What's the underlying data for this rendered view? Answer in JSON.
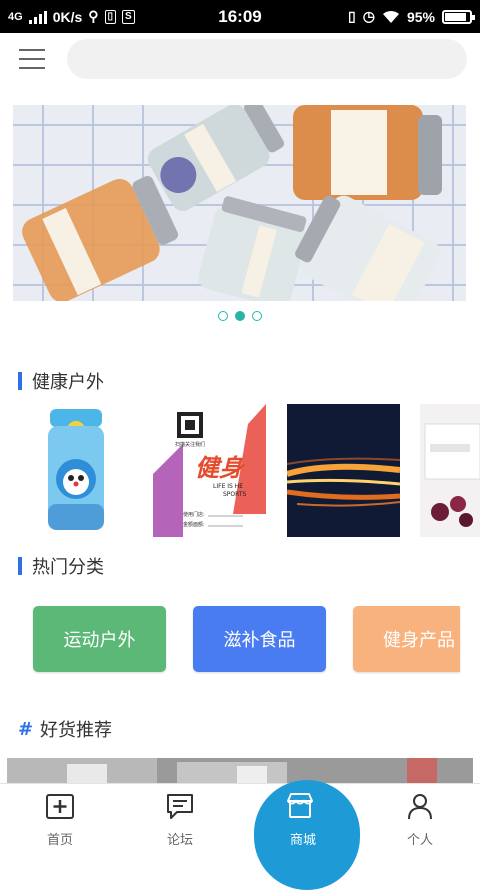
{
  "status_bar": {
    "network": "4G",
    "speed": "0K/s",
    "time": "16:09",
    "battery": "95%"
  },
  "header": {
    "search_placeholder": ""
  },
  "banner": {
    "dot_count": 3,
    "active_dot": 2
  },
  "sections": {
    "outdoor_title": "健康户外",
    "category_title": "热门分类",
    "recommend_title": "好货推荐",
    "recommend_hash": "#"
  },
  "products": [
    {
      "name": "water-bottle"
    },
    {
      "name": "fitness-poster",
      "poster_text": "健身",
      "poster_sub1": "LIFE IS HE",
      "poster_sub2": "SPORTS",
      "qr_caption": "扫描关注我们",
      "line1": "使用门店:",
      "line2": "金额面额:"
    },
    {
      "name": "fire-streaks"
    },
    {
      "name": "gift-box"
    }
  ],
  "categories": [
    {
      "label": "运动户外",
      "color": "#5bb877"
    },
    {
      "label": "滋补食品",
      "color": "#4a7cf1"
    },
    {
      "label": "健身产品",
      "color": "#f8b27e"
    }
  ],
  "tabbar": {
    "items": [
      {
        "label": "首页"
      },
      {
        "label": "论坛"
      },
      {
        "label": "商城"
      },
      {
        "label": "个人"
      }
    ]
  }
}
